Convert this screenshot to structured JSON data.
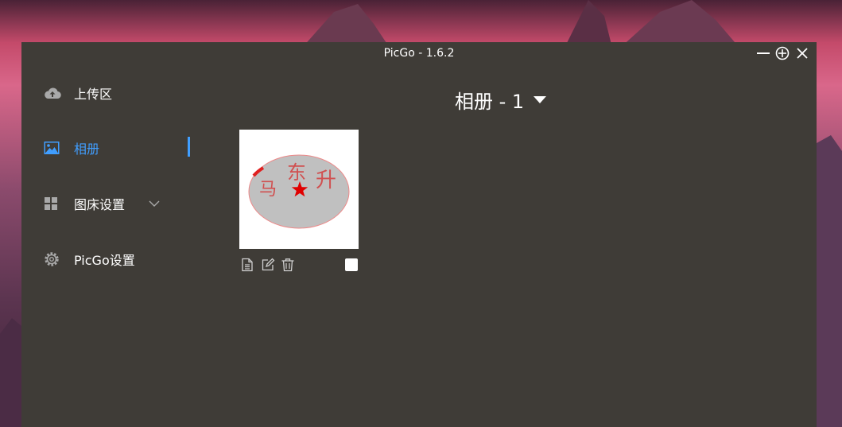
{
  "window": {
    "title": "PicGo - 1.6.2"
  },
  "sidebar": {
    "items": [
      {
        "label": "上传区",
        "icon": "cloud-upload-icon"
      },
      {
        "label": "相册",
        "icon": "image-icon",
        "active": true
      },
      {
        "label": "图床设置",
        "icon": "grid-icon",
        "expandable": true
      },
      {
        "label": "PicGo设置",
        "icon": "gear-icon"
      }
    ]
  },
  "gallery": {
    "title": "相册 - 1",
    "images": [
      {
        "stamp_text": [
          "马",
          "东",
          "升"
        ],
        "actions": [
          "copy-link-icon",
          "edit-icon",
          "delete-icon"
        ],
        "selected": false
      }
    ]
  },
  "colors": {
    "accent": "#409eff",
    "window_bg": "#3f3c37"
  }
}
